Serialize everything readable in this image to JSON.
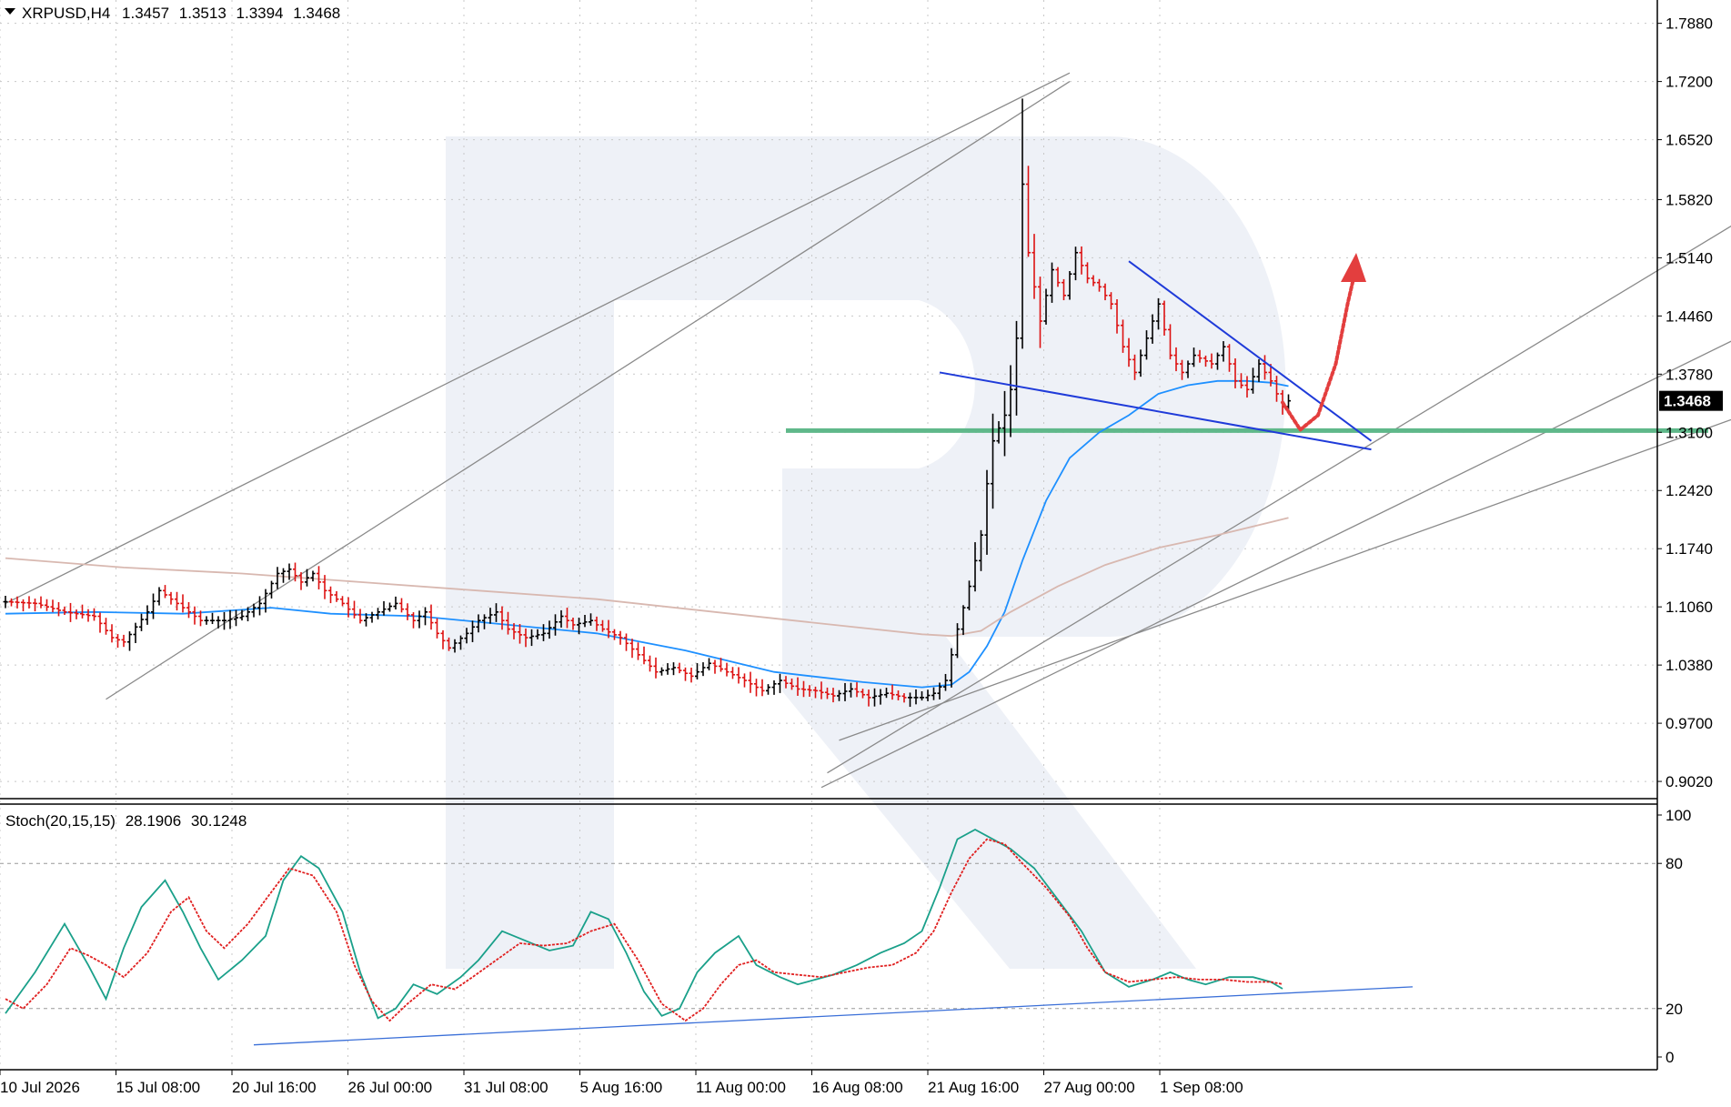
{
  "chart_data": [
    {
      "type": "candlestick",
      "symbol": "XRPUSD,H4",
      "header": {
        "symbol_tf": "XRPUSD,H4",
        "open": "1.3457",
        "high": "1.3513",
        "low": "1.3394",
        "close": "1.3468"
      },
      "y_ticks": [
        "1.7880",
        "1.7200",
        "1.6520",
        "1.5820",
        "1.5140",
        "1.4460",
        "1.3780",
        "1.3100",
        "1.2420",
        "1.1740",
        "1.1060",
        "1.0380",
        "0.9700",
        "0.9020"
      ],
      "ylim": [
        0.8925,
        1.8025
      ],
      "x_ticks": [
        "10 Jul 2026",
        "15 Jul 08:00",
        "20 Jul 16:00",
        "26 Jul 00:00",
        "31 Jul 08:00",
        "5 Aug 16:00",
        "11 Aug 00:00",
        "16 Aug 08:00",
        "21 Aug 16:00",
        "27 Aug 00:00",
        "1 Sep 08:00"
      ],
      "current_price_label": "1.3468",
      "close_path": [
        [
          0,
          1.112
        ],
        [
          5,
          1.11
        ],
        [
          10,
          1.1
        ],
        [
          15,
          1.095
        ],
        [
          18,
          1.07
        ],
        [
          20,
          1.065
        ],
        [
          24,
          1.1
        ],
        [
          26,
          1.125
        ],
        [
          30,
          1.105
        ],
        [
          33,
          1.09
        ],
        [
          37,
          1.09
        ],
        [
          40,
          1.095
        ],
        [
          43,
          1.11
        ],
        [
          46,
          1.145
        ],
        [
          48,
          1.15
        ],
        [
          50,
          1.135
        ],
        [
          52,
          1.145
        ],
        [
          54,
          1.125
        ],
        [
          57,
          1.11
        ],
        [
          60,
          1.09
        ],
        [
          63,
          1.1
        ],
        [
          66,
          1.11
        ],
        [
          69,
          1.09
        ],
        [
          71,
          1.1
        ],
        [
          73,
          1.075
        ],
        [
          75,
          1.058
        ],
        [
          78,
          1.075
        ],
        [
          80,
          1.09
        ],
        [
          83,
          1.1
        ],
        [
          85,
          1.08
        ],
        [
          88,
          1.07
        ],
        [
          91,
          1.075
        ],
        [
          94,
          1.095
        ],
        [
          96,
          1.085
        ],
        [
          99,
          1.09
        ],
        [
          101,
          1.08
        ],
        [
          104,
          1.07
        ],
        [
          107,
          1.05
        ],
        [
          110,
          1.03
        ],
        [
          113,
          1.035
        ],
        [
          116,
          1.025
        ],
        [
          119,
          1.04
        ],
        [
          122,
          1.03
        ],
        [
          125,
          1.02
        ],
        [
          128,
          1.008
        ],
        [
          131,
          1.02
        ],
        [
          134,
          1.01
        ],
        [
          137,
          1.008
        ],
        [
          140,
          1.002
        ],
        [
          143,
          1.01
        ],
        [
          146,
          1.0
        ],
        [
          149,
          1.005
        ],
        [
          152,
          1.0
        ],
        [
          155,
          1.0
        ],
        [
          157,
          1.005
        ],
        [
          159,
          1.02
        ],
        [
          161,
          1.08
        ],
        [
          163,
          1.13
        ],
        [
          165,
          1.19
        ],
        [
          166,
          1.25
        ],
        [
          167,
          1.3
        ],
        [
          169,
          1.33
        ],
        [
          170,
          1.36
        ],
        [
          171,
          1.42
        ],
        [
          172,
          1.6
        ],
        [
          173,
          1.52
        ],
        [
          175,
          1.44
        ],
        [
          177,
          1.5
        ],
        [
          179,
          1.47
        ],
        [
          181,
          1.52
        ],
        [
          183,
          1.49
        ],
        [
          185,
          1.48
        ],
        [
          187,
          1.46
        ],
        [
          189,
          1.41
        ],
        [
          191,
          1.38
        ],
        [
          193,
          1.42
        ],
        [
          195,
          1.46
        ],
        [
          197,
          1.4
        ],
        [
          199,
          1.38
        ],
        [
          201,
          1.4
        ],
        [
          204,
          1.39
        ],
        [
          206,
          1.41
        ],
        [
          208,
          1.37
        ],
        [
          210,
          1.36
        ],
        [
          212,
          1.39
        ],
        [
          214,
          1.37
        ],
        [
          216,
          1.34
        ],
        [
          217,
          1.3468
        ]
      ],
      "candle_count": 218,
      "series": [
        {
          "name": "MA fast",
          "color": "#1e90ff",
          "values": [
            [
              0,
              1.098
            ],
            [
              15,
              1.1
            ],
            [
              30,
              1.098
            ],
            [
              45,
              1.105
            ],
            [
              55,
              1.098
            ],
            [
              70,
              1.095
            ],
            [
              85,
              1.085
            ],
            [
              100,
              1.075
            ],
            [
              115,
              1.055
            ],
            [
              130,
              1.03
            ],
            [
              145,
              1.018
            ],
            [
              155,
              1.012
            ],
            [
              160,
              1.015
            ],
            [
              163,
              1.03
            ],
            [
              166,
              1.06
            ],
            [
              169,
              1.1
            ],
            [
              172,
              1.16
            ],
            [
              176,
              1.23
            ],
            [
              180,
              1.28
            ],
            [
              185,
              1.31
            ],
            [
              190,
              1.33
            ],
            [
              195,
              1.355
            ],
            [
              200,
              1.365
            ],
            [
              205,
              1.37
            ],
            [
              210,
              1.37
            ],
            [
              214,
              1.368
            ],
            [
              217,
              1.364
            ]
          ]
        },
        {
          "name": "MA slow",
          "color": "#d8b8b0",
          "values": [
            [
              0,
              1.163
            ],
            [
              20,
              1.152
            ],
            [
              40,
              1.145
            ],
            [
              60,
              1.135
            ],
            [
              80,
              1.125
            ],
            [
              100,
              1.115
            ],
            [
              120,
              1.1
            ],
            [
              140,
              1.085
            ],
            [
              155,
              1.074
            ],
            [
              160,
              1.072
            ],
            [
              165,
              1.078
            ],
            [
              170,
              1.1
            ],
            [
              178,
              1.13
            ],
            [
              186,
              1.155
            ],
            [
              195,
              1.175
            ],
            [
              205,
              1.19
            ],
            [
              217,
              1.21
            ]
          ]
        }
      ],
      "overlays": {
        "support_level": {
          "value": 1.312,
          "color": "#5fb88a",
          "x_range": [
            132,
            288
          ]
        },
        "wedge_upper": {
          "from": [
            190,
            1.51
          ],
          "to": [
            231,
            1.3
          ],
          "color": "#1f3bd9"
        },
        "wedge_lower": {
          "from": [
            158,
            1.38
          ],
          "to": [
            231,
            1.29
          ],
          "color": "#1f3bd9"
        },
        "forecast_arrow": {
          "points": [
            [
              216,
              1.345
            ],
            [
              219,
              1.313
            ],
            [
              222,
              1.33
            ],
            [
              225,
              1.39
            ],
            [
              227,
              1.46
            ],
            [
              228,
              1.49
            ]
          ],
          "color": "#e33e3e"
        },
        "channel_lines": [
          {
            "from": [
              0,
              1.11
            ],
            "to": [
              180,
              1.73
            ]
          },
          {
            "from": [
              17,
              0.998
            ],
            "to": [
              180,
              1.72
            ]
          },
          {
            "from": [
              139,
              0.912
            ],
            "to": [
              300,
              1.585
            ]
          },
          {
            "from": [
              138,
              0.895
            ],
            "to": [
              300,
              1.444
            ]
          },
          {
            "from": [
              141,
              0.95
            ],
            "to": [
              300,
              1.345
            ]
          }
        ]
      }
    },
    {
      "type": "line",
      "indicator": "Stoch(20,15,15)",
      "header": {
        "name": "Stoch(20,15,15)",
        "main": "28.1906",
        "signal": "30.1248"
      },
      "y_ticks": [
        "100",
        "80",
        "20",
        "0"
      ],
      "levels": [
        80,
        20
      ],
      "ylim": [
        0,
        100
      ],
      "series": [
        {
          "name": "main",
          "color": "#1aa08a",
          "values": [
            [
              0,
              18
            ],
            [
              5,
              35
            ],
            [
              10,
              55
            ],
            [
              14,
              38
            ],
            [
              17,
              24
            ],
            [
              20,
              45
            ],
            [
              23,
              62
            ],
            [
              27,
              73
            ],
            [
              30,
              60
            ],
            [
              33,
              45
            ],
            [
              36,
              32
            ],
            [
              40,
              40
            ],
            [
              44,
              50
            ],
            [
              47,
              73
            ],
            [
              50,
              83
            ],
            [
              53,
              78
            ],
            [
              57,
              60
            ],
            [
              60,
              35
            ],
            [
              63,
              16
            ],
            [
              66,
              20
            ],
            [
              69,
              30
            ],
            [
              73,
              26
            ],
            [
              77,
              33
            ],
            [
              80,
              40
            ],
            [
              84,
              52
            ],
            [
              88,
              48
            ],
            [
              92,
              44
            ],
            [
              96,
              46
            ],
            [
              99,
              60
            ],
            [
              102,
              57
            ],
            [
              105,
              43
            ],
            [
              108,
              27
            ],
            [
              111,
              17
            ],
            [
              114,
              20
            ],
            [
              117,
              35
            ],
            [
              120,
              43
            ],
            [
              124,
              50
            ],
            [
              127,
              38
            ],
            [
              131,
              33
            ],
            [
              134,
              30
            ],
            [
              137,
              32
            ],
            [
              140,
              34
            ],
            [
              144,
              38
            ],
            [
              148,
              43
            ],
            [
              152,
              47
            ],
            [
              155,
              52
            ],
            [
              158,
              70
            ],
            [
              161,
              90
            ],
            [
              164,
              94
            ],
            [
              167,
              90
            ],
            [
              170,
              86
            ],
            [
              174,
              78
            ],
            [
              178,
              65
            ],
            [
              182,
              52
            ],
            [
              186,
              35
            ],
            [
              190,
              29
            ],
            [
              194,
              32
            ],
            [
              197,
              35
            ],
            [
              200,
              32
            ],
            [
              203,
              30
            ],
            [
              207,
              33
            ],
            [
              211,
              33
            ],
            [
              214,
              31
            ],
            [
              216,
              28.19
            ]
          ]
        },
        {
          "name": "signal",
          "color": "#e02020",
          "values": [
            [
              0,
              24
            ],
            [
              3,
              20
            ],
            [
              7,
              30
            ],
            [
              11,
              45
            ],
            [
              14,
              42
            ],
            [
              17,
              38
            ],
            [
              20,
              33
            ],
            [
              24,
              43
            ],
            [
              28,
              60
            ],
            [
              31,
              66
            ],
            [
              34,
              52
            ],
            [
              37,
              45
            ],
            [
              41,
              55
            ],
            [
              44,
              65
            ],
            [
              48,
              78
            ],
            [
              52,
              75
            ],
            [
              56,
              60
            ],
            [
              59,
              38
            ],
            [
              62,
              23
            ],
            [
              65,
              15
            ],
            [
              68,
              22
            ],
            [
              72,
              30
            ],
            [
              76,
              28
            ],
            [
              79,
              33
            ],
            [
              83,
              40
            ],
            [
              87,
              47
            ],
            [
              91,
              46
            ],
            [
              95,
              47
            ],
            [
              99,
              52
            ],
            [
              103,
              55
            ],
            [
              107,
              40
            ],
            [
              111,
              22
            ],
            [
              115,
              15
            ],
            [
              118,
              20
            ],
            [
              121,
              30
            ],
            [
              124,
              38
            ],
            [
              127,
              40
            ],
            [
              130,
              35
            ],
            [
              134,
              34
            ],
            [
              138,
              33
            ],
            [
              142,
              35
            ],
            [
              146,
              37
            ],
            [
              150,
              38
            ],
            [
              154,
              43
            ],
            [
              157,
              52
            ],
            [
              160,
              68
            ],
            [
              163,
              82
            ],
            [
              166,
              90
            ],
            [
              169,
              88
            ],
            [
              172,
              80
            ],
            [
              176,
              70
            ],
            [
              180,
              58
            ],
            [
              183,
              45
            ],
            [
              186,
              35
            ],
            [
              190,
              31
            ],
            [
              194,
              32
            ],
            [
              198,
              33
            ],
            [
              202,
              32
            ],
            [
              206,
              32
            ],
            [
              210,
              31
            ],
            [
              214,
              31
            ],
            [
              216,
              30.12
            ]
          ]
        }
      ],
      "trendline": {
        "from": [
          42,
          5
        ],
        "to": [
          238,
          29
        ],
        "color": "#3a6fd8"
      }
    }
  ],
  "colors": {
    "bull": "#000000",
    "bear": "#dd1111",
    "grid": "#c8c8c8",
    "tag_bg": "#000000",
    "watermark": "#eef1f7"
  }
}
